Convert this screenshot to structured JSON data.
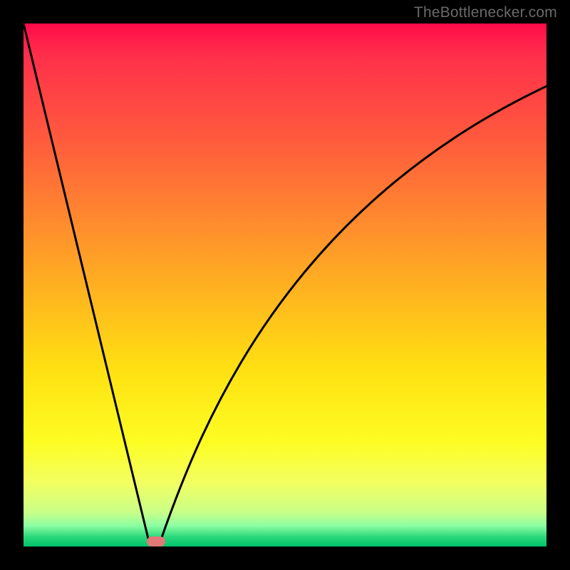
{
  "watermark": "TheBottlenecker.com",
  "chart_data": {
    "type": "line",
    "title": "",
    "xlabel": "",
    "ylabel": "",
    "xlim": [
      0,
      100
    ],
    "ylim": [
      0,
      100
    ],
    "grid": false,
    "legend": false,
    "series": [
      {
        "name": "left-branch",
        "x": [
          0,
          5,
          10,
          15,
          20,
          24
        ],
        "values": [
          100,
          79,
          58,
          37,
          16,
          0
        ]
      },
      {
        "name": "right-branch",
        "x": [
          26,
          28,
          30,
          33,
          36,
          40,
          45,
          50,
          55,
          60,
          66,
          72,
          80,
          88,
          94,
          100
        ],
        "values": [
          0,
          6,
          12,
          20,
          28,
          37,
          46,
          54,
          60,
          66,
          71,
          75,
          80,
          84,
          86,
          88
        ]
      }
    ],
    "marker": {
      "name": "optimal-point",
      "x": 25,
      "y": 0,
      "color": "#e07878"
    },
    "background_gradient": {
      "stops": [
        {
          "pos": 0.0,
          "color": "#ff0a4a"
        },
        {
          "pos": 0.22,
          "color": "#ff5a3d"
        },
        {
          "pos": 0.52,
          "color": "#ffb61f"
        },
        {
          "pos": 0.8,
          "color": "#fdfd22"
        },
        {
          "pos": 0.96,
          "color": "#8dffa2"
        },
        {
          "pos": 1.0,
          "color": "#00c46a"
        }
      ]
    }
  }
}
